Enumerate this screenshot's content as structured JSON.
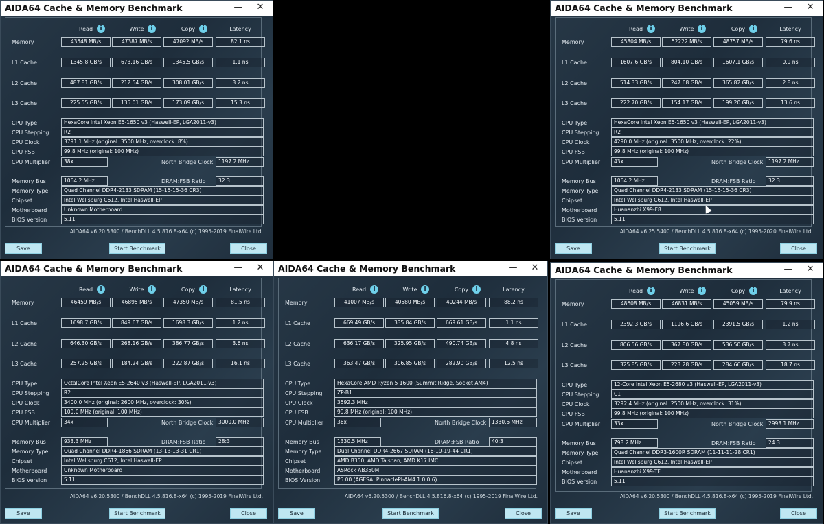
{
  "common": {
    "title": "AIDA64 Cache & Memory Benchmark",
    "minimize_glyph": "—",
    "close_glyph": "✕",
    "info_glyph": "i",
    "col_read": "Read",
    "col_write": "Write",
    "col_copy": "Copy",
    "col_latency": "Latency",
    "row_memory": "Memory",
    "row_l1": "L1 Cache",
    "row_l2": "L2 Cache",
    "row_l3": "L3 Cache",
    "lbl_cpu_type": "CPU Type",
    "lbl_cpu_stepping": "CPU Stepping",
    "lbl_cpu_clock": "CPU Clock",
    "lbl_cpu_fsb": "CPU FSB",
    "lbl_cpu_multiplier": "CPU Multiplier",
    "lbl_nb_clock": "North Bridge Clock",
    "lbl_memory_bus": "Memory Bus",
    "lbl_dram_ratio": "DRAM:FSB Ratio",
    "lbl_memory_type": "Memory Type",
    "lbl_chipset": "Chipset",
    "lbl_motherboard": "Motherboard",
    "lbl_bios": "BIOS Version",
    "btn_save": "Save",
    "btn_start": "Start Benchmark",
    "btn_close": "Close"
  },
  "windows": [
    {
      "memory": [
        "43548 MB/s",
        "47387 MB/s",
        "47092 MB/s",
        "82.1 ns"
      ],
      "l1": [
        "1345.8 GB/s",
        "673.16 GB/s",
        "1345.5 GB/s",
        "1.1 ns"
      ],
      "l2": [
        "487.81 GB/s",
        "212.54 GB/s",
        "308.01 GB/s",
        "3.2 ns"
      ],
      "l3": [
        "225.55 GB/s",
        "135.01 GB/s",
        "173.09 GB/s",
        "15.3 ns"
      ],
      "cpu_type": "HexaCore Intel Xeon E5-1650 v3  (Haswell-EP, LGA2011-v3)",
      "cpu_stepping": "R2",
      "cpu_clock": "3791.1 MHz  (original: 3500 MHz, overclock: 8%)",
      "cpu_fsb": "99.8 MHz  (original: 100 MHz)",
      "cpu_multiplier": "38x",
      "nb_clock": "1197.2 MHz",
      "memory_bus": "1064.2 MHz",
      "dram_ratio": "32:3",
      "memory_type": "Quad Channel DDR4-2133 SDRAM  (15-15-15-36 CR3)",
      "chipset": "Intel Wellsburg C612, Intel Haswell-EP",
      "motherboard": "Unknown Motherboard",
      "bios": "5.11",
      "footer": "AIDA64 v6.20.5300 / BenchDLL 4.5.816.8-x64  (c) 1995-2019 FinalWire Ltd."
    },
    {
      "memory": [
        "45804 MB/s",
        "52222 MB/s",
        "48757 MB/s",
        "79.6 ns"
      ],
      "l1": [
        "1607.6 GB/s",
        "804.10 GB/s",
        "1607.1 GB/s",
        "0.9 ns"
      ],
      "l2": [
        "514.33 GB/s",
        "247.68 GB/s",
        "365.82 GB/s",
        "2.8 ns"
      ],
      "l3": [
        "222.70 GB/s",
        "154.17 GB/s",
        "199.20 GB/s",
        "13.6 ns"
      ],
      "cpu_type": "HexaCore Intel Xeon E5-1650 v3  (Haswell-EP, LGA2011-v3)",
      "cpu_stepping": "R2",
      "cpu_clock": "4290.0 MHz  (original: 3500 MHz, overclock: 22%)",
      "cpu_fsb": "99.8 MHz  (original: 100 MHz)",
      "cpu_multiplier": "43x",
      "nb_clock": "1197.2 MHz",
      "memory_bus": "1064.2 MHz",
      "dram_ratio": "32:3",
      "memory_type": "Quad Channel DDR4-2133 SDRAM  (15-15-15-36 CR3)",
      "chipset": "Intel Wellsburg C612, Intel Haswell-EP",
      "motherboard": "Huananzhi X99-F8",
      "bios": "5.11",
      "footer": "AIDA64 v6.25.5400 / BenchDLL 4.5.816.8-x64  (c) 1995-2020 FinalWire Ltd."
    },
    {
      "memory": [
        "46459 MB/s",
        "46895 MB/s",
        "47350 MB/s",
        "81.5 ns"
      ],
      "l1": [
        "1698.7 GB/s",
        "849.67 GB/s",
        "1698.3 GB/s",
        "1.2 ns"
      ],
      "l2": [
        "646.30 GB/s",
        "268.16 GB/s",
        "386.77 GB/s",
        "3.6 ns"
      ],
      "l3": [
        "257.25 GB/s",
        "184.24 GB/s",
        "222.87 GB/s",
        "16.1 ns"
      ],
      "cpu_type": "OctalCore Intel Xeon E5-2640 v3  (Haswell-EP, LGA2011-v3)",
      "cpu_stepping": "R2",
      "cpu_clock": "3400.0 MHz  (original: 2600 MHz, overclock: 30%)",
      "cpu_fsb": "100.0 MHz  (original: 100 MHz)",
      "cpu_multiplier": "34x",
      "nb_clock": "3000.0 MHz",
      "memory_bus": "933.3 MHz",
      "dram_ratio": "28:3",
      "memory_type": "Quad Channel DDR4-1866 SDRAM  (13-13-13-31 CR1)",
      "chipset": "Intel Wellsburg C612, Intel Haswell-EP",
      "motherboard": "Unknown Motherboard",
      "bios": "5.11",
      "footer": "AIDA64 v6.20.5300 / BenchDLL 4.5.816.8-x64  (c) 1995-2019 FinalWire Ltd."
    },
    {
      "memory": [
        "41007 MB/s",
        "40580 MB/s",
        "40244 MB/s",
        "88.2 ns"
      ],
      "l1": [
        "669.49 GB/s",
        "335.84 GB/s",
        "669.61 GB/s",
        "1.1 ns"
      ],
      "l2": [
        "636.17 GB/s",
        "325.95 GB/s",
        "490.74 GB/s",
        "4.8 ns"
      ],
      "l3": [
        "363.47 GB/s",
        "306.85 GB/s",
        "282.90 GB/s",
        "12.5 ns"
      ],
      "cpu_type": "HexaCore AMD Ryzen 5 1600  (Summit Ridge, Socket AM4)",
      "cpu_stepping": "ZP-B1",
      "cpu_clock": "3592.3 MHz",
      "cpu_fsb": "99.8 MHz  (original: 100 MHz)",
      "cpu_multiplier": "36x",
      "nb_clock": "1330.5 MHz",
      "memory_bus": "1330.5 MHz",
      "dram_ratio": "40:3",
      "memory_type": "Dual Channel DDR4-2667 SDRAM  (16-19-19-44 CR1)",
      "chipset": "AMD B350, AMD Taishan, AMD K17 IMC",
      "motherboard": "ASRock AB350M",
      "bios": "P5.00  (AGESA: PinnaclePI-AM4 1.0.0.6)",
      "footer": "AIDA64 v6.20.5300 / BenchDLL 4.5.816.8-x64  (c) 1995-2019 FinalWire Ltd."
    },
    {
      "memory": [
        "48608 MB/s",
        "46831 MB/s",
        "45059 MB/s",
        "79.9 ns"
      ],
      "l1": [
        "2392.3 GB/s",
        "1196.6 GB/s",
        "2391.5 GB/s",
        "1.2 ns"
      ],
      "l2": [
        "806.56 GB/s",
        "367.80 GB/s",
        "536.50 GB/s",
        "3.7 ns"
      ],
      "l3": [
        "325.85 GB/s",
        "223.28 GB/s",
        "284.66 GB/s",
        "18.7 ns"
      ],
      "cpu_type": "12-Core Intel Xeon E5-2680 v3  (Haswell-EP, LGA2011-v3)",
      "cpu_stepping": "C1",
      "cpu_clock": "3292.4 MHz  (original: 2500 MHz, overclock: 31%)",
      "cpu_fsb": "99.8 MHz  (original: 100 MHz)",
      "cpu_multiplier": "33x",
      "nb_clock": "2993.1 MHz",
      "memory_bus": "798.2 MHz",
      "dram_ratio": "24:3",
      "memory_type": "Quad Channel DDR3-1600R SDRAM  (11-11-11-28 CR1)",
      "chipset": "Intel Wellsburg C612, Intel Haswell-EP",
      "motherboard": "Huananzhi X99-TF",
      "bios": "5.11",
      "footer": "AIDA64 v6.20.5300 / BenchDLL 4.5.816.8-x64  (c) 1995-2019 FinalWire Ltd."
    }
  ]
}
